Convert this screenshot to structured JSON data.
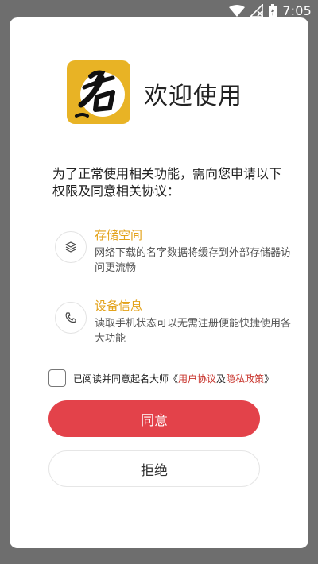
{
  "status_bar": {
    "time": "7:05",
    "icons": [
      "wifi-icon",
      "signal-icon",
      "battery-charging-icon"
    ]
  },
  "dialog": {
    "logo_icon": "app-logo-name-calligraphy",
    "welcome_title": "欢迎使用",
    "intro": "为了正常使用相关功能，需向您申请以下权限及同意相关协议：",
    "permissions": [
      {
        "icon": "layers-icon",
        "title": "存储空间",
        "description": "网络下载的名字数据将缓存到外部存储器访问更流畅"
      },
      {
        "icon": "phone-icon",
        "title": "设备信息",
        "description": "读取手机状态可以无需注册便能快捷使用各大功能"
      }
    ],
    "agreement": {
      "checked": false,
      "prefix": "已阅读并同意起名大师《",
      "user_agreement": "用户协议",
      "and": "及",
      "privacy_policy": "隐私政策",
      "suffix": "》"
    },
    "agree_button": "同意",
    "reject_button": "拒绝"
  },
  "colors": {
    "accent_red": "#e3424a",
    "link_red": "#c8342c",
    "perm_title_orange": "#e3a21a",
    "logo_gold": "#e8b325"
  }
}
